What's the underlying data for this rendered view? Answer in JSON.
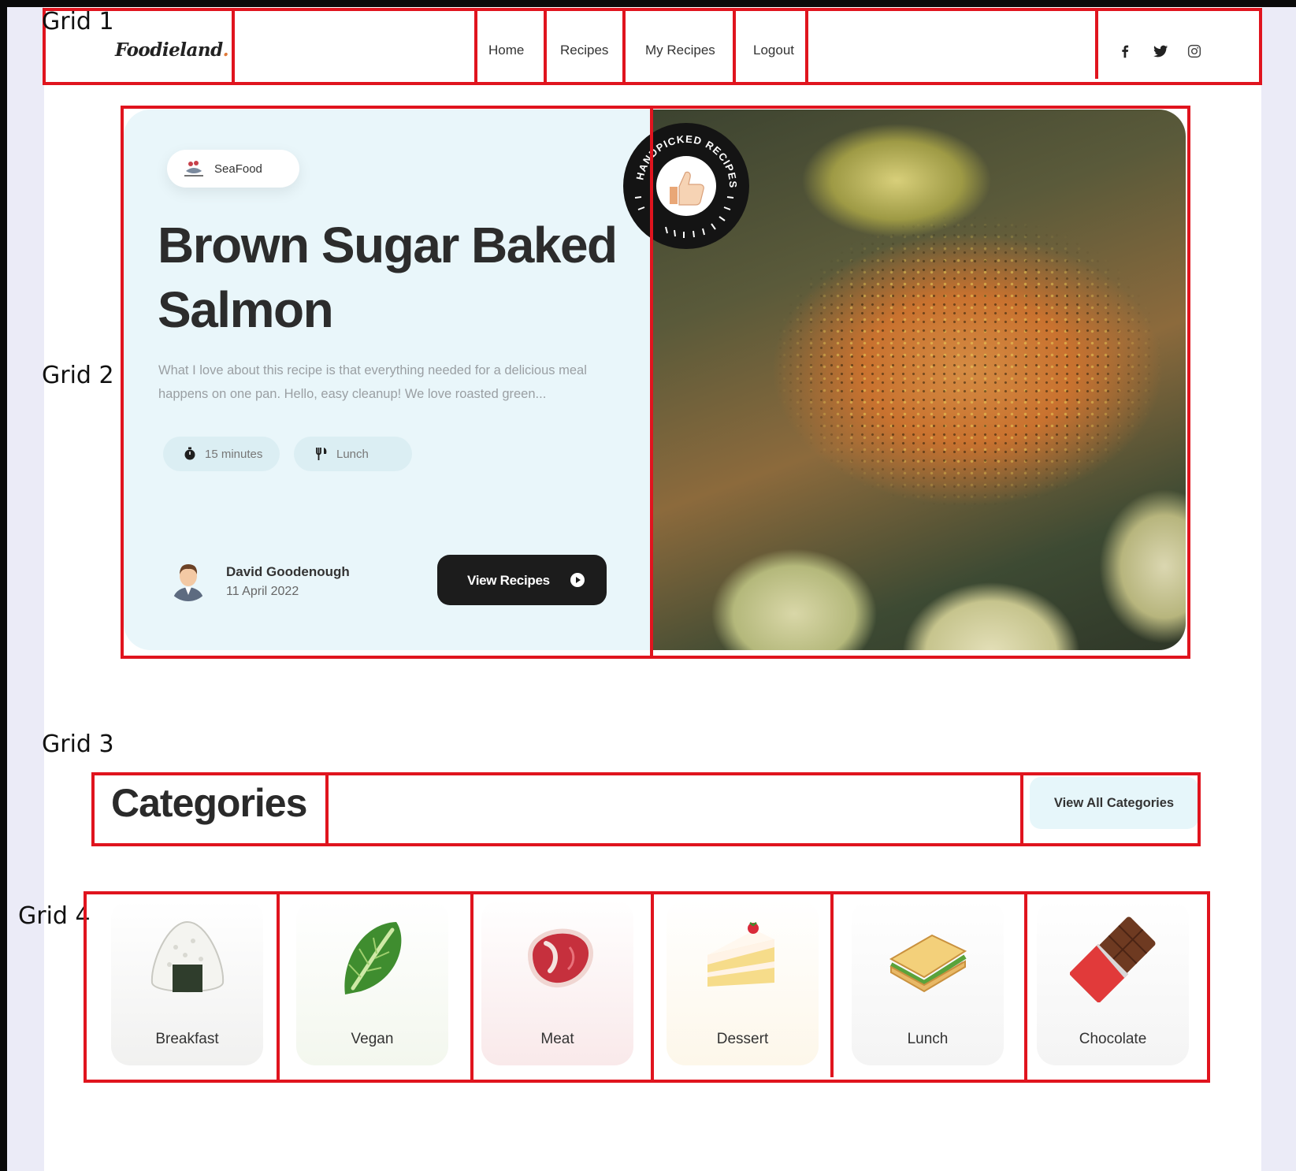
{
  "annotations": {
    "grid_1": "Grid 1",
    "grid_2": "Grid 2",
    "grid_3": "Grid 3",
    "grid_4": "Grid 4"
  },
  "nav": {
    "brand": "Foodieland",
    "brand_dot": ".",
    "links": [
      "Home",
      "Recipes",
      "My Recipes",
      "Logout"
    ],
    "social": [
      "facebook-icon",
      "twitter-icon",
      "instagram-icon"
    ]
  },
  "hero": {
    "category": "SeaFood",
    "title": "Brown Sugar Baked Salmon",
    "description": "What I love about this recipe is that everything needed for a delicious meal happens on one pan. Hello, easy cleanup! We love roasted green...",
    "time": "15 minutes",
    "meal": "Lunch",
    "author": "David Goodenough",
    "date": "11 April 2022",
    "button": "View Recipes",
    "stamp_text": "HANDPICKED RECIPES"
  },
  "categories": {
    "title": "Categories",
    "view_all": "View All Categories",
    "items": [
      {
        "label": "Breakfast",
        "icon": "rice-ball-icon",
        "color": "#f1f1f0"
      },
      {
        "label": "Vegan",
        "icon": "leafy-green-icon",
        "color": "#f3f7ee"
      },
      {
        "label": "Meat",
        "icon": "steak-icon",
        "color": "#f9e9ea"
      },
      {
        "label": "Dessert",
        "icon": "cake-slice-icon",
        "color": "#fdf7ea"
      },
      {
        "label": "Lunch",
        "icon": "sandwich-icon",
        "color": "#f4f4f4"
      },
      {
        "label": "Chocolate",
        "icon": "chocolate-bar-icon",
        "color": "#f4f4f4"
      }
    ]
  },
  "colors": {
    "outline": "#e0141e",
    "dark_button": "#1c1c1c",
    "hero_bg": "#e9f6fa"
  }
}
